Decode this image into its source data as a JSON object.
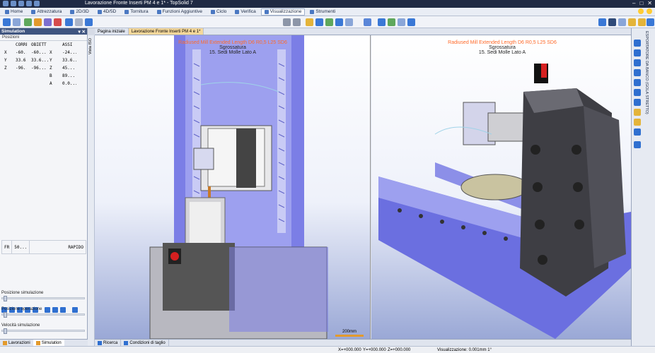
{
  "window": {
    "title": "Lavorazione Fronte Inserti PM 4 e 1* - TopSolid 7",
    "controls": [
      "–",
      "□",
      "✕"
    ]
  },
  "menu": {
    "tabs": [
      {
        "label": "Home",
        "active": false
      },
      {
        "label": "Attrezzatura",
        "active": false
      },
      {
        "label": "2D/3D",
        "active": false
      },
      {
        "label": "4D/5D",
        "active": false
      },
      {
        "label": "Tornitura",
        "active": false
      },
      {
        "label": "Funzioni Aggiuntive",
        "active": false
      },
      {
        "label": "Ciclo",
        "active": false
      },
      {
        "label": "Verifica",
        "active": false
      },
      {
        "label": "Visualizzazione",
        "active": true
      },
      {
        "label": "Strumenti",
        "active": false
      }
    ]
  },
  "simulation_panel": {
    "title": "Simulation",
    "pin": "▾ ✕",
    "section": "Posizioni",
    "headers": [
      "",
      "CORRE",
      "OBIETT",
      "",
      "ASSI"
    ],
    "rows": [
      [
        "X",
        "-60...",
        "-60...",
        "X",
        "-24..."
      ],
      [
        "Y",
        "33.6...",
        "33.6...",
        "Y",
        "33.6..."
      ],
      [
        "Z",
        "-96...",
        "-96...",
        "Z",
        "45..."
      ],
      [
        "",
        "",
        "",
        "B",
        "89..."
      ],
      [
        "",
        "",
        "",
        "A",
        "0.0..."
      ]
    ],
    "fr_label": "FR",
    "fr_value": "50...",
    "mode": "RAPIDO",
    "sliders": [
      {
        "label": "Posizione simulazione"
      },
      {
        "label": "Posizione operazione"
      },
      {
        "label": "Velocità simulazione"
      }
    ],
    "tabs": [
      {
        "label": "Lavorazioni",
        "active": false
      },
      {
        "label": "Simulation",
        "active": true
      }
    ]
  },
  "vertical_tab": "Vista ISO",
  "document_tabs": [
    {
      "label": "Pagina iniziale",
      "active": false
    },
    {
      "label": "Lavorazione Fronte Inserti PM 4 e 1*",
      "active": true
    }
  ],
  "viewports": {
    "left": {
      "tool": "Radiused Mill Extended Length D6 R0,5 L25 SD6",
      "operation": "Sgrossatura",
      "step": "15. Sedi Molle Lato A"
    },
    "right": {
      "tool": "Radiused Mill Extended Length D6 R0,5 L25 SD6",
      "operation": "Sgrossatura",
      "step": "15. Sedi Molle Lato A"
    }
  },
  "scale": {
    "label": "200mm"
  },
  "right_sidebar": {
    "label": "ESPORTATORE DA BANCO (GOLA STRETTO)"
  },
  "bottom_tabs": [
    {
      "label": "Ricerca"
    },
    {
      "label": "Condizioni di taglio"
    }
  ],
  "status": {
    "x": "X=+000.000",
    "y": "Y=+000.000",
    "z": "Z=+000.000",
    "zoom": "Visualizzazione: 0.001mm 1°"
  },
  "colors": {
    "accent_orange": "#e39a2c",
    "tool_label": "#ff6a2a",
    "machine_blue": "#6b6fe0",
    "title_blue": "#1f2a44"
  }
}
